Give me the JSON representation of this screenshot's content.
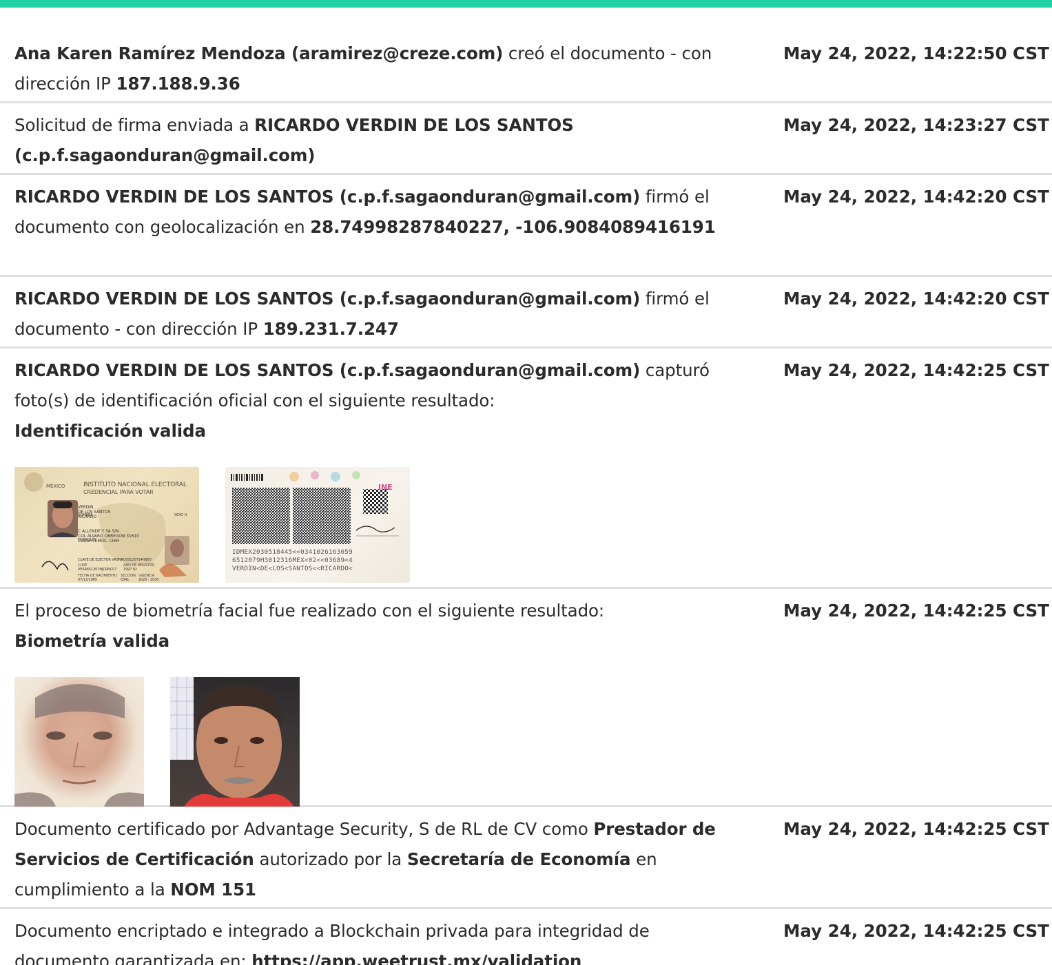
{
  "colors": {
    "accent_bar": "#1fd1a2",
    "divider": "#dedede",
    "text": "#2b2b2b"
  },
  "entries": [
    {
      "timestamp": "May 24, 2022, 14:22:50 CST",
      "parts": [
        "Ana Karen Ramírez Mendoza (aramirez@creze.com)",
        " creó el documento - con dirección IP ",
        "187.188.9.36"
      ]
    },
    {
      "timestamp": "May 24, 2022, 14:23:27 CST",
      "parts": [
        "Solicitud de firma enviada a ",
        "RICARDO VERDIN DE LOS SANTOS (c.p.f.sagaonduran@gmail.com)"
      ]
    },
    {
      "timestamp": "May 24, 2022, 14:42:20 CST",
      "parts": [
        "RICARDO VERDIN DE LOS SANTOS (c.p.f.sagaonduran@gmail.com)",
        " firmó el documento con geolocalización en ",
        "28.74998287840227, -106.9084089416191"
      ]
    },
    {
      "timestamp": "May 24, 2022, 14:42:20 CST",
      "parts": [
        "RICARDO VERDIN DE LOS SANTOS (c.p.f.sagaonduran@gmail.com)",
        " firmó el documento - con dirección IP ",
        "189.231.7.247"
      ]
    },
    {
      "timestamp": "May 24, 2022, 14:42:25 CST",
      "parts": [
        "RICARDO VERDIN DE LOS SANTOS (c.p.f.sagaonduran@gmail.com)",
        " capturó foto(s) de identificación oficial con el siguiente resultado:",
        "Identificación valida"
      ],
      "id_front": {
        "country": "MÉXICO",
        "institute": "INSTITUTO NACIONAL ELECTORAL",
        "credential": "CREDENCIAL PARA VOTAR",
        "name_label": "NOMBRE",
        "name_lines": [
          "VERDIN",
          "DE LOS SANTOS",
          "RICARDO"
        ],
        "sex": "SEXO H",
        "address_label": "DOMICILIO",
        "address_lines": [
          "C ALLENDE Y 3A S/N",
          "COL ALVARO OBREGON 31610",
          "CUAUHTEMOC, CHIH"
        ],
        "elector": "CLAVE DE ELECTOR VRSNRC65120714H800",
        "curp_label": "CURP",
        "curp": "VESR651207HJCRNC07",
        "registro_label": "AÑO DE REGISTRO",
        "registro": "1997 02",
        "birth_label": "FECHA DE NACIMIENTO",
        "birth": "07/12/1965",
        "section_label": "SECCIÓN",
        "section": "0341",
        "validity_label": "VIGENCIA",
        "validity": "2020 - 2030"
      },
      "id_back": {
        "logo": "INE",
        "mrz": [
          "IDMEX2030518445<<0341026163059",
          "6512079H3012316MEX<02<<03689<4",
          "VERDIN<DE<LOS<SANTOS<<RICARDO<"
        ]
      }
    },
    {
      "timestamp": "May 24, 2022, 14:42:25 CST",
      "parts": [
        "El proceso de biometría facial fue realizado con el siguiente resultado:",
        "Biometría valida"
      ]
    },
    {
      "timestamp": "May 24, 2022, 14:42:25 CST",
      "parts": [
        "Documento certificado por Advantage Security, S de RL de CV como ",
        "Prestador de Servicios de Certificación",
        " autorizado por la ",
        "Secretaría de Economía",
        " en cumplimiento a la ",
        "NOM 151"
      ]
    },
    {
      "timestamp": "May 24, 2022, 14:42:25 CST",
      "parts": [
        "Documento encriptado e integrado a Blockchain privada para integridad de documento garantizada en: ",
        "https://app.weetrust.mx/validation"
      ]
    }
  ]
}
